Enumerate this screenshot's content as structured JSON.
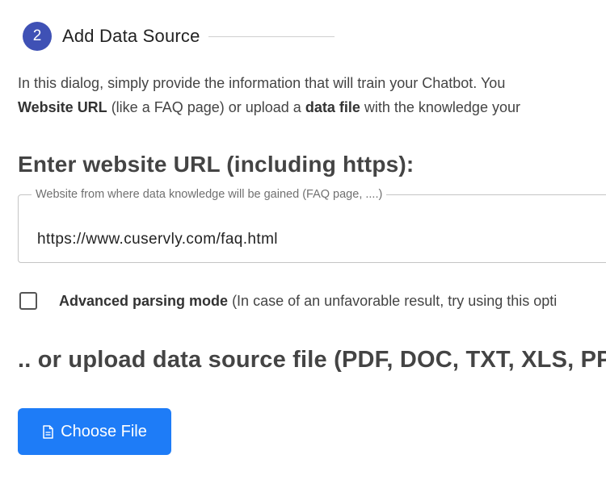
{
  "step": {
    "number": "2",
    "title": "Add Data Source"
  },
  "intro": {
    "line1": "In this dialog, simply provide the information that will train your Chatbot. You",
    "line2_bold1": "Website URL",
    "line2_text1": " (like a FAQ page) or upload a ",
    "line2_bold2": "data file",
    "line2_text2": " with the knowledge your"
  },
  "url_section": {
    "heading": "Enter website URL (including https):",
    "field_label": "Website from where data knowledge will be gained (FAQ page, ....)",
    "field_value": "https://www.cuservly.com/faq.html"
  },
  "advanced": {
    "label_bold": "Advanced parsing mode",
    "label_text": " (In case of an unfavorable result, try using this opti",
    "checked": false
  },
  "upload_section": {
    "heading": ".. or upload data source file (PDF, DOC, TXT, XLS, PPT",
    "button_label": "Choose File"
  },
  "colors": {
    "step_badge": "#3f51b5",
    "button": "#1e7cf7"
  },
  "icons": {
    "button_icon": "file-icon"
  }
}
